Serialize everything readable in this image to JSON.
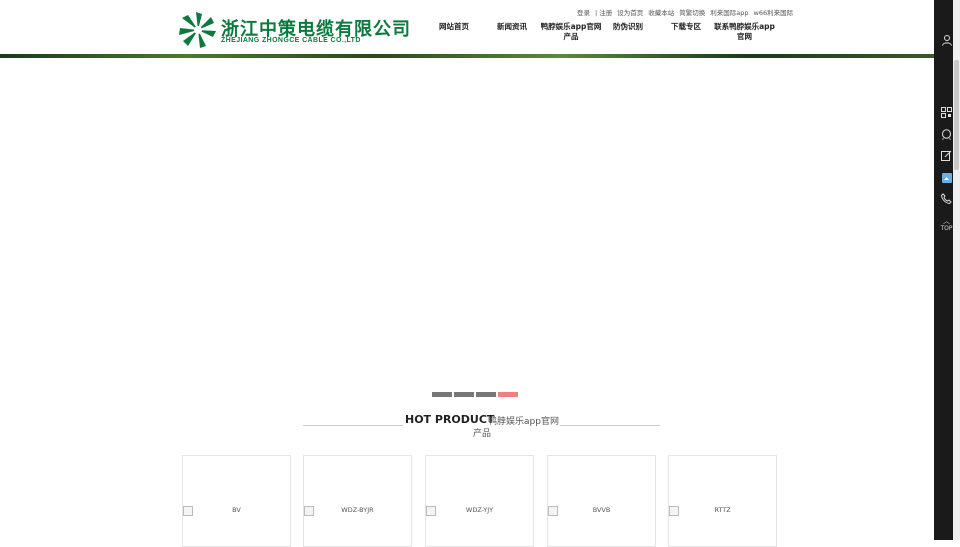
{
  "logo": {
    "cn": "浙江中策电缆有限公司",
    "en": "ZHEJIANG ZHONGCE CABLE CO.,LTD"
  },
  "toplinks": [
    "登录",
    "| 注册",
    "设为首页",
    "收藏本站",
    "简繁切换",
    "利来国际app",
    "w66利来国际"
  ],
  "nav": [
    {
      "label": "网站首页"
    },
    {
      "label": "新闻资讯"
    },
    {
      "label": "鸭脖娱乐app官网产品"
    },
    {
      "label": "防伪识别"
    },
    {
      "label": "下载专区"
    },
    {
      "label": "联系鸭脖娱乐app官网"
    }
  ],
  "slider": {
    "active_index": 3,
    "count": 4
  },
  "section": {
    "title_en": "HOT PRODUCT",
    "title_cn_1": "鸭脖娱乐app官网",
    "title_cn_2": "产品"
  },
  "products": [
    {
      "label": "BV"
    },
    {
      "label": "WDZ-BYJR"
    },
    {
      "label": "WDZ-YJY"
    },
    {
      "label": "BVVB"
    },
    {
      "label": "RTTZ"
    }
  ],
  "sidebar": {
    "top_label": "TOP"
  },
  "colors": {
    "brand_green": "#0c7a3e",
    "active_dot": "#f08080",
    "sidebar_bg": "#1a1a1a"
  }
}
